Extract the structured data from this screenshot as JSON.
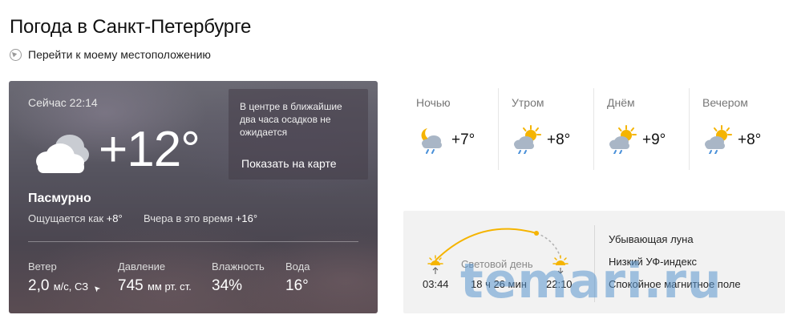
{
  "page": {
    "title": "Погода в Санкт-Петербурге",
    "locate_link": "Перейти к моему местоположению"
  },
  "now": {
    "time_label": "Сейчас 22:14",
    "temperature": "+12°",
    "condition": "Пасмурно",
    "feels_like_label": "Ощущается как",
    "feels_like_value": "+8°",
    "yesterday_label": "Вчера в это время",
    "yesterday_value": "+16°",
    "icon": "cloudy-icon",
    "nowcast_text": "В центре в ближайшие два часа осадков не ожидается",
    "nowcast_link": "Показать на карте",
    "params": {
      "wind": {
        "label": "Ветер",
        "value": "2,0",
        "unit": "м/с, СЗ"
      },
      "pressure": {
        "label": "Давление",
        "value": "745",
        "unit": "мм рт. ст."
      },
      "humidity": {
        "label": "Влажность",
        "value": "34%"
      },
      "water": {
        "label": "Вода",
        "value": "16°"
      }
    }
  },
  "day_parts": [
    {
      "name": "Ночью",
      "temp": "+7°",
      "icon": "moon-cloud-rain-icon"
    },
    {
      "name": "Утром",
      "temp": "+8°",
      "icon": "sun-cloud-rain-icon"
    },
    {
      "name": "Днём",
      "temp": "+9°",
      "icon": "sun-cloud-rain-icon"
    },
    {
      "name": "Вечером",
      "temp": "+8°",
      "icon": "sun-cloud-rain-icon"
    }
  ],
  "sun": {
    "sunrise": "03:44",
    "sunset": "22:10",
    "daylight_label": "Световой день",
    "daylight_length": "18 ч 26 мин",
    "moon": "Убывающая луна",
    "uv": "Низкий УФ-индекс",
    "magnetic": "Спокойное магнитное поле"
  },
  "watermark": "temari.ru",
  "colors": {
    "sun": "#f5b400",
    "rain": "#4a90d9",
    "cloud": "#a9b6c6"
  }
}
